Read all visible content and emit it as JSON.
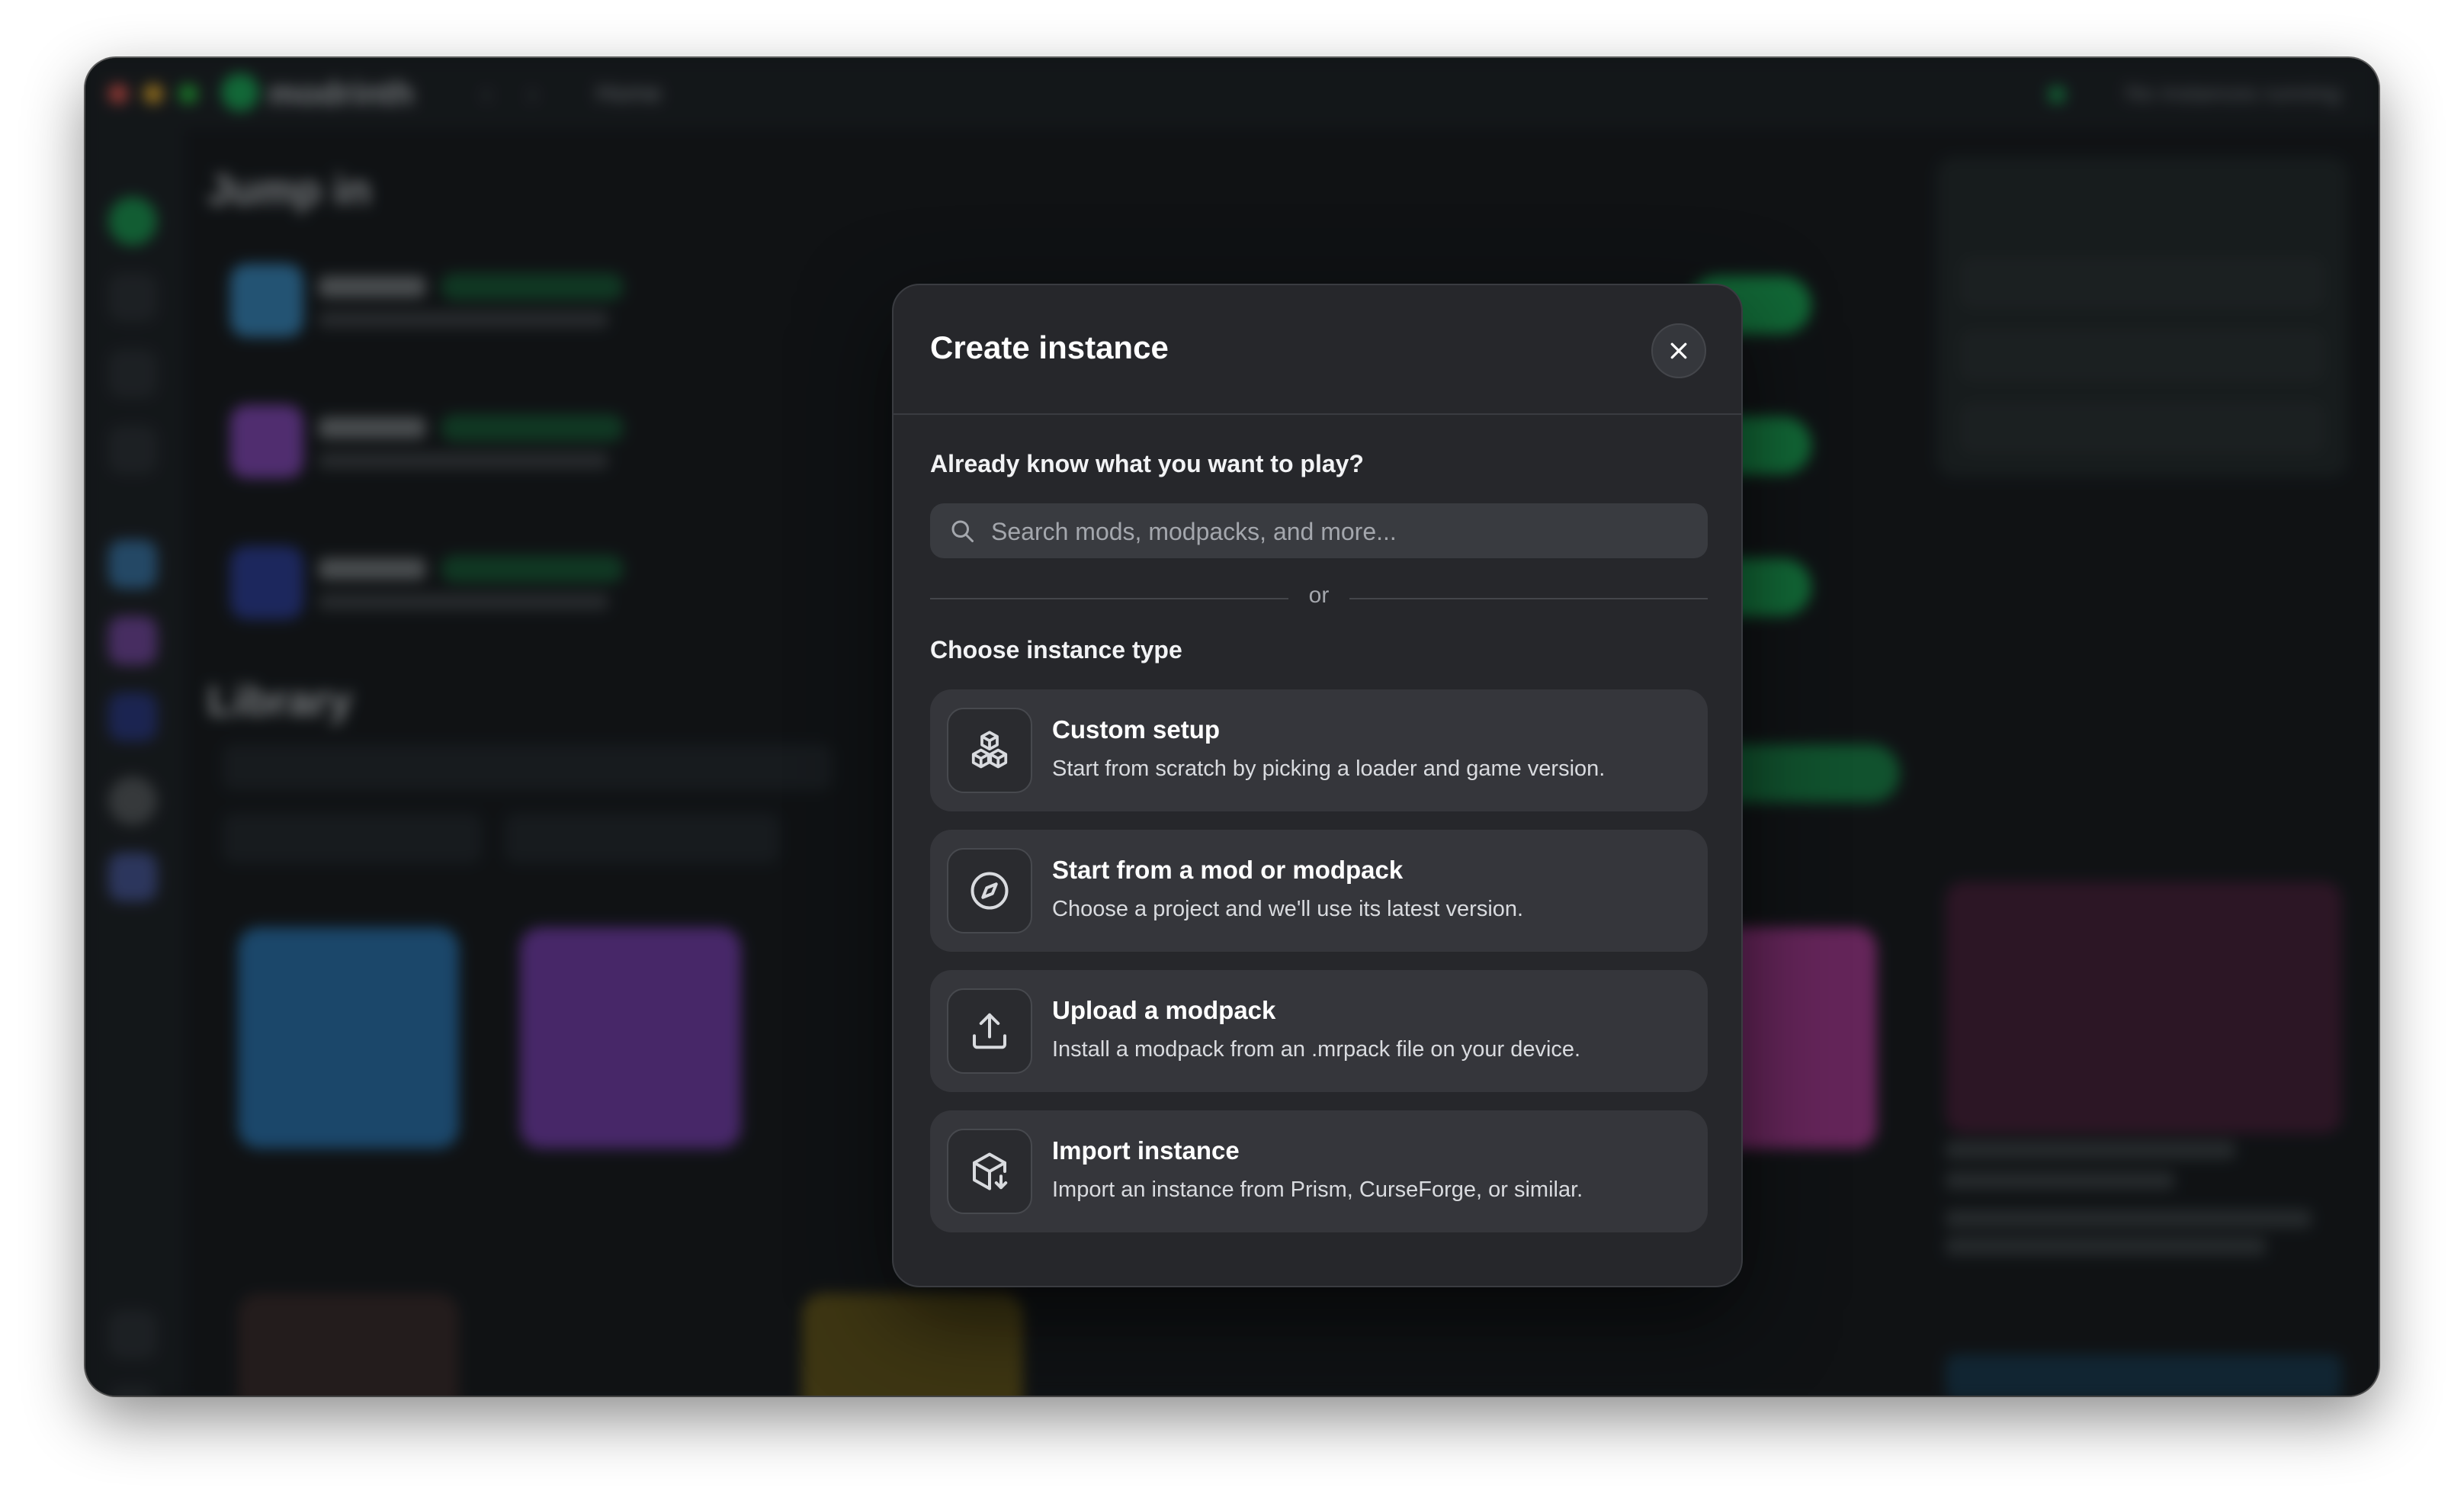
{
  "app": {
    "brand": "modrinth",
    "breadcrumb": "Home",
    "running_status": "No instances running",
    "sections": {
      "jump_in": "Jump in",
      "library": "Library"
    }
  },
  "modal": {
    "title": "Create instance",
    "search_heading": "Already know what you want to play?",
    "search_placeholder": "Search mods, modpacks, and more...",
    "or_label": "or",
    "choose_heading": "Choose instance type",
    "options": [
      {
        "title": "Custom setup",
        "description": "Start from scratch by picking a loader and game version.",
        "icon": "cubes-icon"
      },
      {
        "title": "Start from a mod or modpack",
        "description": "Choose a project and we'll use its latest version.",
        "icon": "compass-icon"
      },
      {
        "title": "Upload a modpack",
        "description": "Install a modpack from an .mrpack file on your device.",
        "icon": "upload-icon"
      },
      {
        "title": "Import instance",
        "description": "Import an instance from Prism, CurseForge, or similar.",
        "icon": "box-import-icon"
      }
    ]
  },
  "colors": {
    "accent_green": "#1bd96a",
    "modal_bg": "#26272b",
    "option_bg": "#35363b"
  }
}
